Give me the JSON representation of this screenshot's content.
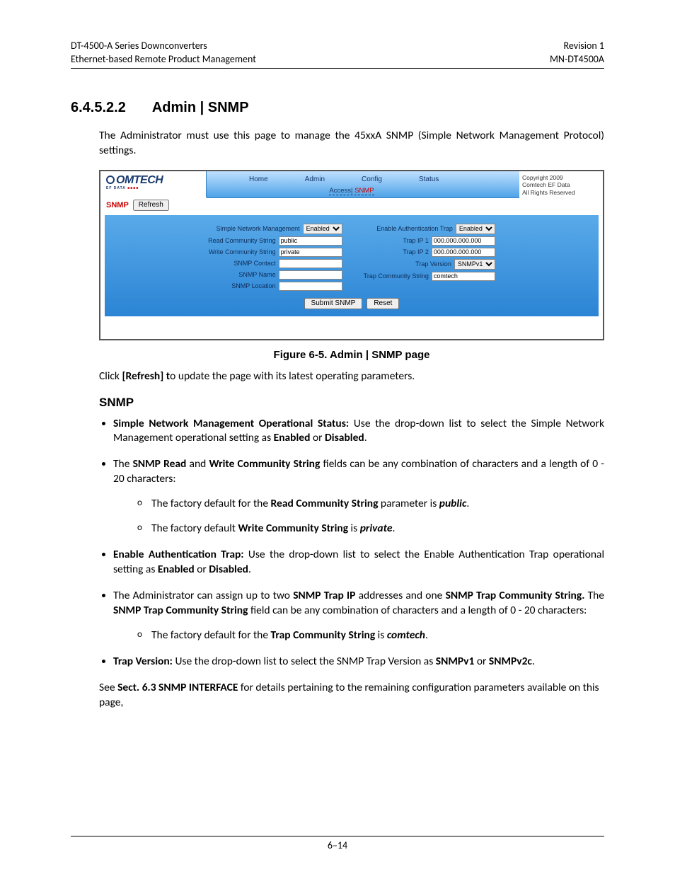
{
  "header": {
    "left_line1": "DT-4500-A Series Downconverters",
    "left_line2": "Ethernet-based Remote Product Management",
    "right_line1": "Revision 1",
    "right_line2": "MN-DT4500A"
  },
  "section": {
    "number": "6.4.5.2.2",
    "title": "Admin | SNMP"
  },
  "intro_para": "The Administrator must use this page to manage the 45xxA SNMP (Simple Network Management Protocol) settings.",
  "screenshot": {
    "logo_main": "OMTECH",
    "logo_sub_plain": "EF DATA ",
    "logo_sub_red": "■■■■",
    "copyright_l1": "Copyright 2009",
    "copyright_l2": "Comtech EF Data",
    "copyright_l3": "All Rights Reserved",
    "nav": {
      "home": "Home",
      "admin": "Admin",
      "config": "Config",
      "status": "Status"
    },
    "subnav_prefix": "Access| ",
    "subnav_sel": "SNMP",
    "bar2_label": "SNMP",
    "bar2_btn": "Refresh",
    "left": {
      "snm_label": "Simple Network Management",
      "snm_value": "Enabled",
      "read_label": "Read Community String",
      "read_value": "public",
      "write_label": "Write Community String",
      "write_value": "private",
      "contact_label": "SNMP Contact",
      "contact_value": "",
      "name_label": "SNMP Name",
      "name_value": "",
      "loc_label": "SNMP Location",
      "loc_value": ""
    },
    "right": {
      "auth_label": "Enable Authentication Trap",
      "auth_value": "Enabled",
      "ip1_label": "Trap IP 1",
      "ip1_value": "000.000.000.000",
      "ip2_label": "Trap IP 2",
      "ip2_value": "000.000.000.000",
      "ver_label": "Trap Version",
      "ver_value": "SNMPv1",
      "comm_label": "Trap Community String",
      "comm_value": "comtech"
    },
    "submit_btn": "Submit SNMP",
    "reset_btn": "Reset"
  },
  "figure_caption": "Figure 6-5. Admin | SNMP page",
  "click_refresh_prefix": "Click ",
  "click_refresh_bold": "[Refresh] t",
  "click_refresh_rest": "o update the page with its latest operating parameters.",
  "snmp_heading": "SNMP",
  "bullets": {
    "b1_a": "Simple Network Management Operational Status:",
    "b1_b": " Use the drop-down list to select the Simple Network Management operational setting as ",
    "b1_c": "Enabled",
    "b1_d": " or ",
    "b1_e": "Disabled",
    "b1_f": ".",
    "b2_a": "The ",
    "b2_b": "SNMP Read",
    "b2_c": " and ",
    "b2_d": "Write Community String",
    "b2_e": " fields can be any combination of characters and a length of 0 - 20 characters:",
    "b2s1_a": "The factory default for the ",
    "b2s1_b": "Read Community String",
    "b2s1_c": " parameter is ",
    "b2s1_d": "public",
    "b2s1_e": ".",
    "b2s2_a": "The factory default ",
    "b2s2_b": "Write Community String",
    "b2s2_c": " is ",
    "b2s2_d": "private",
    "b2s2_e": ".",
    "b3_a": "Enable Authentication Trap:",
    "b3_b": " Use the drop-down list to select the Enable Authentication Trap operational setting as ",
    "b3_c": "Enabled",
    "b3_d": " or ",
    "b3_e": "Disabled",
    "b3_f": ".",
    "b4_a": "The Administrator can assign up to two ",
    "b4_b": "SNMP Trap IP",
    "b4_c": " addresses and one ",
    "b4_d": "SNMP Trap Community String.",
    "b4_e": " The ",
    "b4_f": "SNMP Trap Community String",
    "b4_g": " field can be any combination of characters and a length of 0 - 20 characters:",
    "b4s1_a": "The factory default for the ",
    "b4s1_b": "Trap Community String",
    "b4s1_c": " is ",
    "b4s1_d": "comtech",
    "b4s1_e": ".",
    "b5_a": "Trap Version:",
    "b5_b": " Use the drop-down list to select the SNMP Trap Version as ",
    "b5_c": "SNMPv1",
    "b5_d": " or ",
    "b5_e": "SNMPv2c",
    "b5_f": "."
  },
  "closing_a": "See ",
  "closing_b": "Sect. 6.3 SNMP INTERFACE",
  "closing_c": " for details pertaining to the remaining configuration parameters available on this page,",
  "page_number": "6–14"
}
